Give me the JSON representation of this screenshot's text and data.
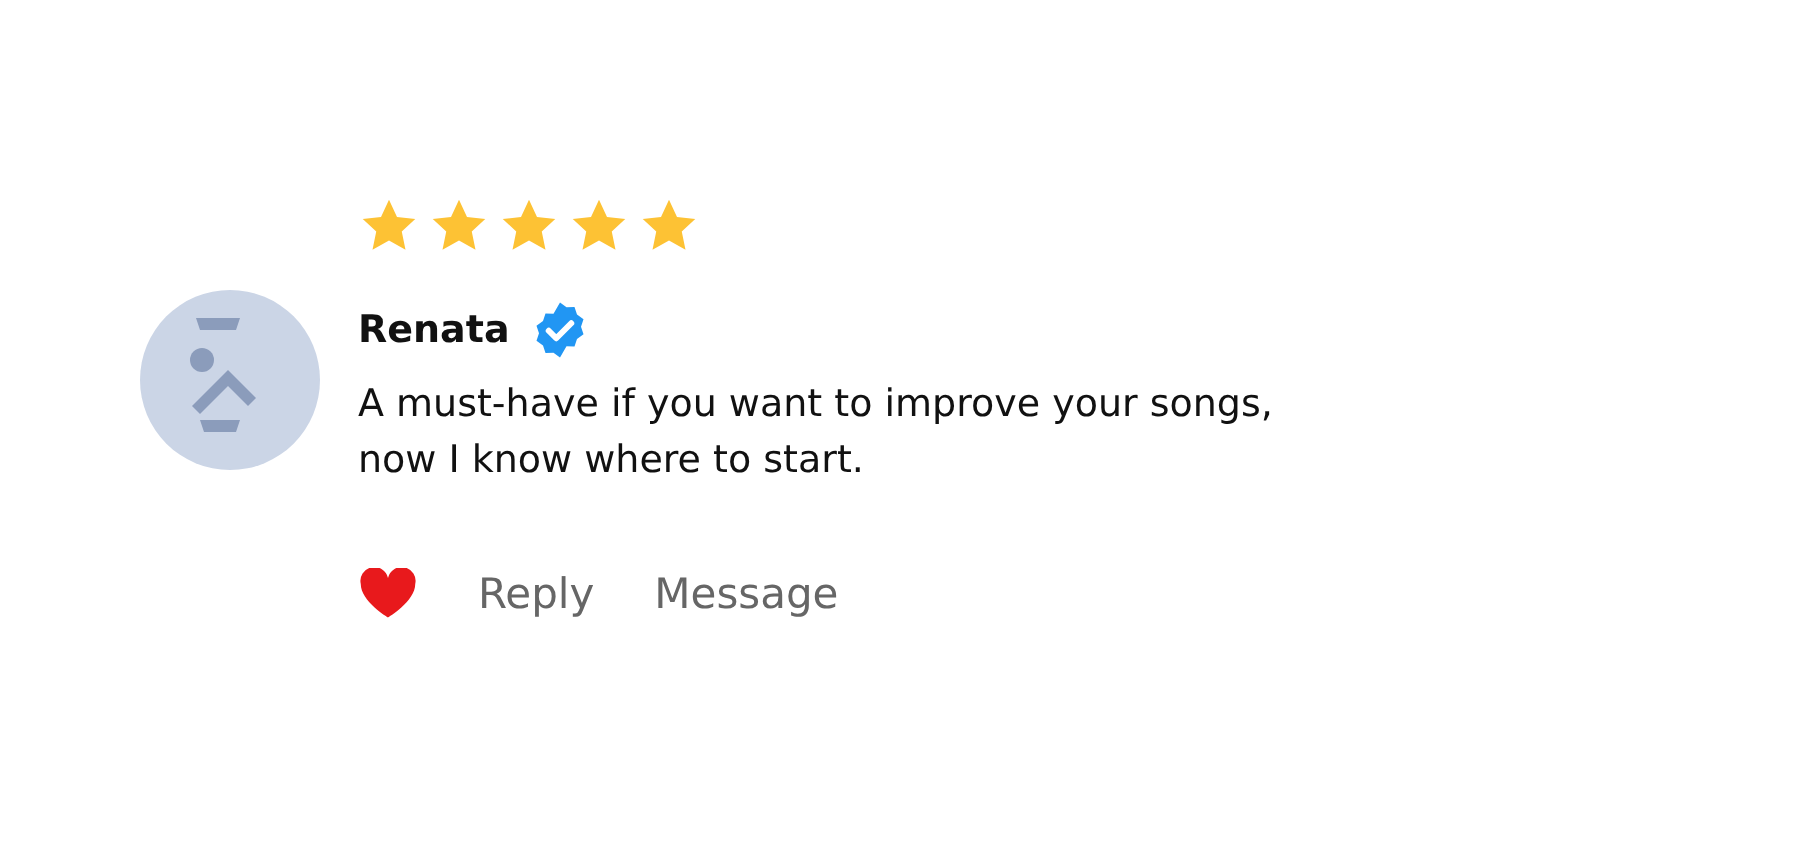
{
  "review": {
    "stars": 5,
    "author": "Renata",
    "verified": true,
    "text": "A must-have if you want to improve your songs,\nnow I know where to start.",
    "liked": true,
    "actions": [
      "Reply",
      "Message"
    ]
  }
}
